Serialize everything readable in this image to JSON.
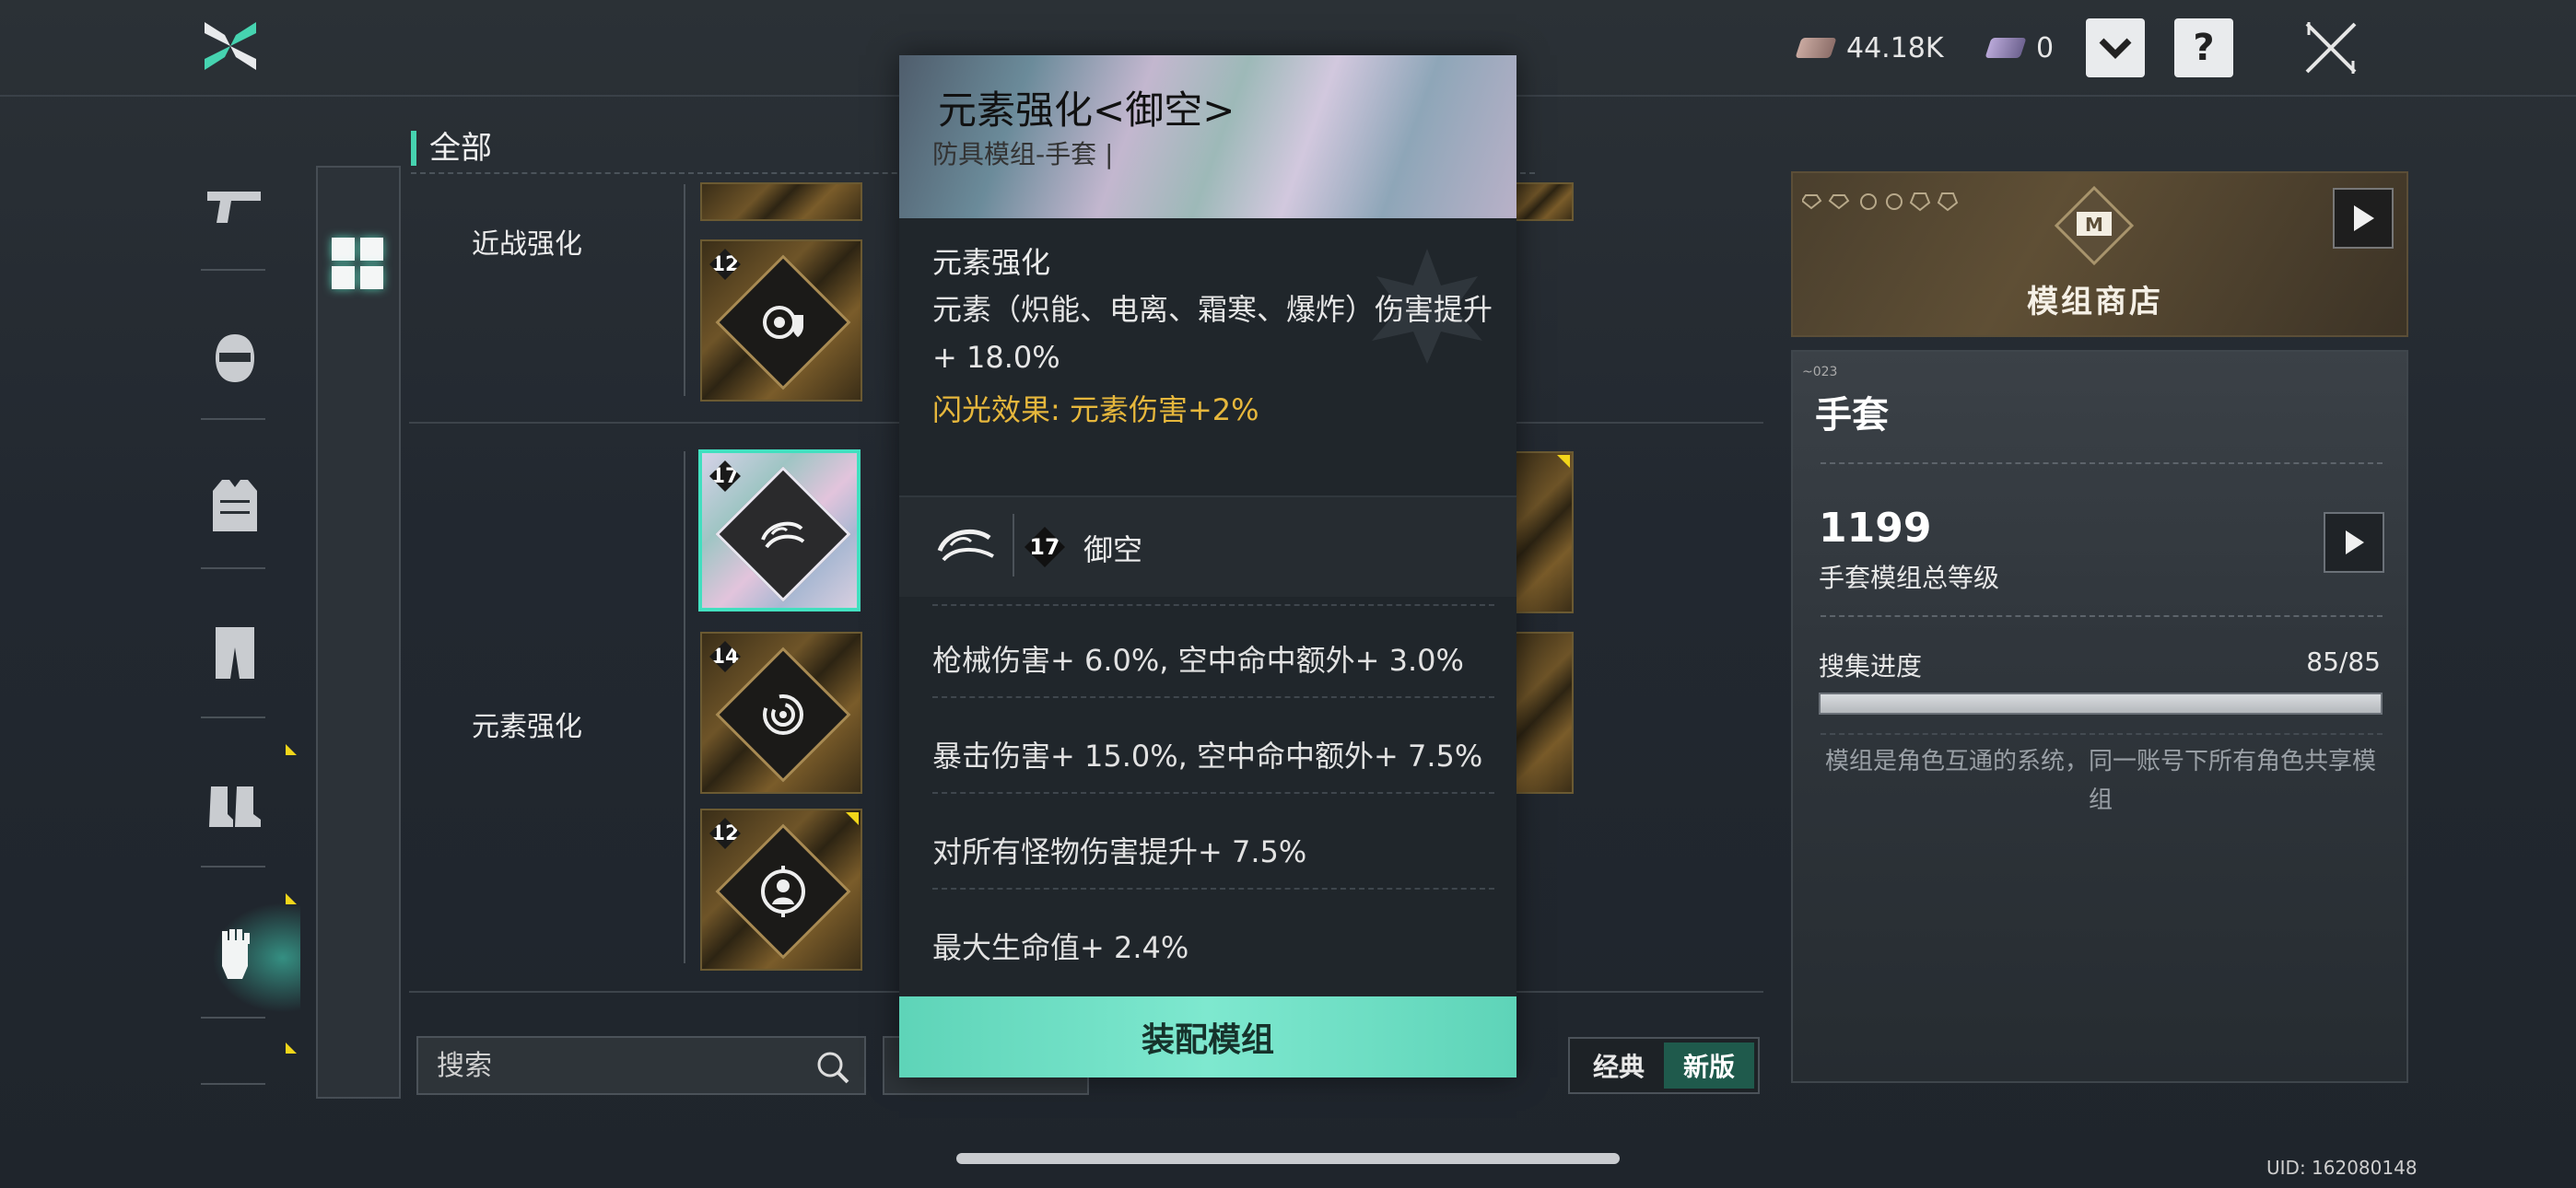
{
  "topbar": {
    "currency1_value": "44.18K",
    "currency1_icon": "credits-ticket-icon",
    "currency2_value": "0",
    "currency2_icon": "premium-ticket-icon",
    "dropdown_icon": "chevron-down-icon",
    "help_label": "?",
    "close_icon": "close-icon"
  },
  "nav": {
    "items": [
      "pistol-icon",
      "helmet-icon",
      "armor-vest-icon",
      "pants-icon",
      "boots-icon",
      "gloves-icon"
    ],
    "active": "gloves-icon"
  },
  "category": {
    "all_label": "全部",
    "grid_icon": "grid-icon"
  },
  "sections": [
    {
      "label": "近战强化"
    },
    {
      "label": "元素强化"
    }
  ],
  "modules": [
    {
      "level": "12",
      "icon": "vortex-shield-icon",
      "selected": false
    },
    {
      "level": "17",
      "icon": "wind-swirl-icon",
      "selected": true
    },
    {
      "level": "14",
      "icon": "vortex-icon",
      "selected": false
    },
    {
      "level": "12",
      "icon": "target-person-icon",
      "selected": false
    }
  ],
  "search": {
    "placeholder": "搜索"
  },
  "version_toggle": {
    "classic": "经典",
    "new": "新版",
    "active": "新版"
  },
  "popup": {
    "title": "元素强化<御空>",
    "subtitle": "防具模组-手套 |",
    "desc_heading": "元素强化",
    "desc_line1": "元素（炽能、电离、霜寒、爆炸）伤害提升",
    "desc_line2": "+ 18.0%",
    "flash_effect": "闪光效果: 元素伤害+2%",
    "set_level": "17",
    "set_name": "御空",
    "stats": [
      "枪械伤害+ 6.0%, 空中命中额外+ 3.0%",
      "暴击伤害+ 15.0%, 空中命中额外+ 7.5%",
      "对所有怪物伤害提升+ 7.5%",
      "最大生命值+ 2.4%"
    ],
    "equip_button": "装配模组"
  },
  "shop": {
    "title": "模组商店",
    "arrow_icon": "play-arrow-icon"
  },
  "info": {
    "title": "手套",
    "total_level": "1199",
    "total_level_label": "手套模组总等级",
    "progress_label": "搜集进度",
    "progress_value": "85/85",
    "progress_fraction": 1.0,
    "note": "模组是角色互通的系统，同一账号下所有角色共享模组"
  },
  "uid": "UID: 162080148",
  "colors": {
    "accent": "#46d3b0",
    "gold": "#e6b73c",
    "equip": "#6fe0c6"
  }
}
